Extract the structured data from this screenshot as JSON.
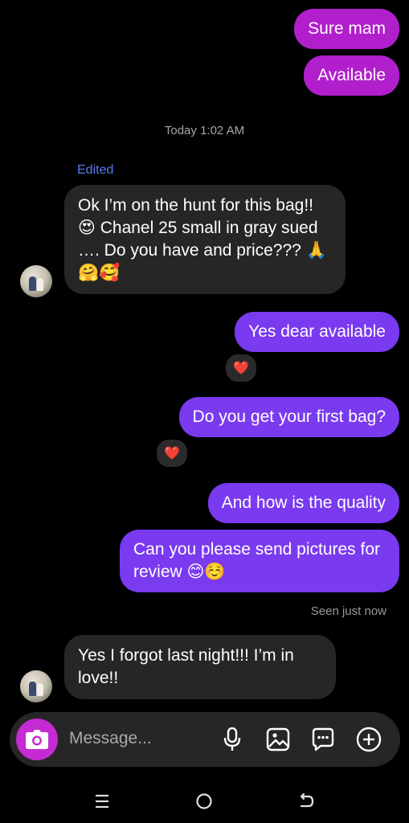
{
  "messages": {
    "out1": "Sure mam",
    "out2": "Available",
    "timestamp": "Today 1:02 AM",
    "edited_label": "Edited",
    "in1": "Ok I’m on the hunt for this bag!! 😍 Chanel 25 small in gray sued …. Do you have and price??? 🙏🤗🥰",
    "out3": "Yes dear available",
    "out4": "Do you get your first bag?",
    "out5": "And how is the quality",
    "out6": "Can you please send pictures for review 😊☺️",
    "seen": "Seen just now",
    "in2": "Yes I forgot last night!!! I’m in love!!"
  },
  "reactions": {
    "r1": "❤️",
    "r2": "❤️"
  },
  "composer": {
    "placeholder": "Message..."
  },
  "colors": {
    "outgoing_magenta": "#b11fcc",
    "outgoing_purple": "#7a3af0",
    "incoming": "#262626",
    "camera": "#c62ad2"
  },
  "icons": [
    "camera-icon",
    "microphone-icon",
    "gallery-icon",
    "sticker-icon",
    "plus-icon",
    "menu-nav-icon",
    "home-nav-icon",
    "back-nav-icon"
  ]
}
